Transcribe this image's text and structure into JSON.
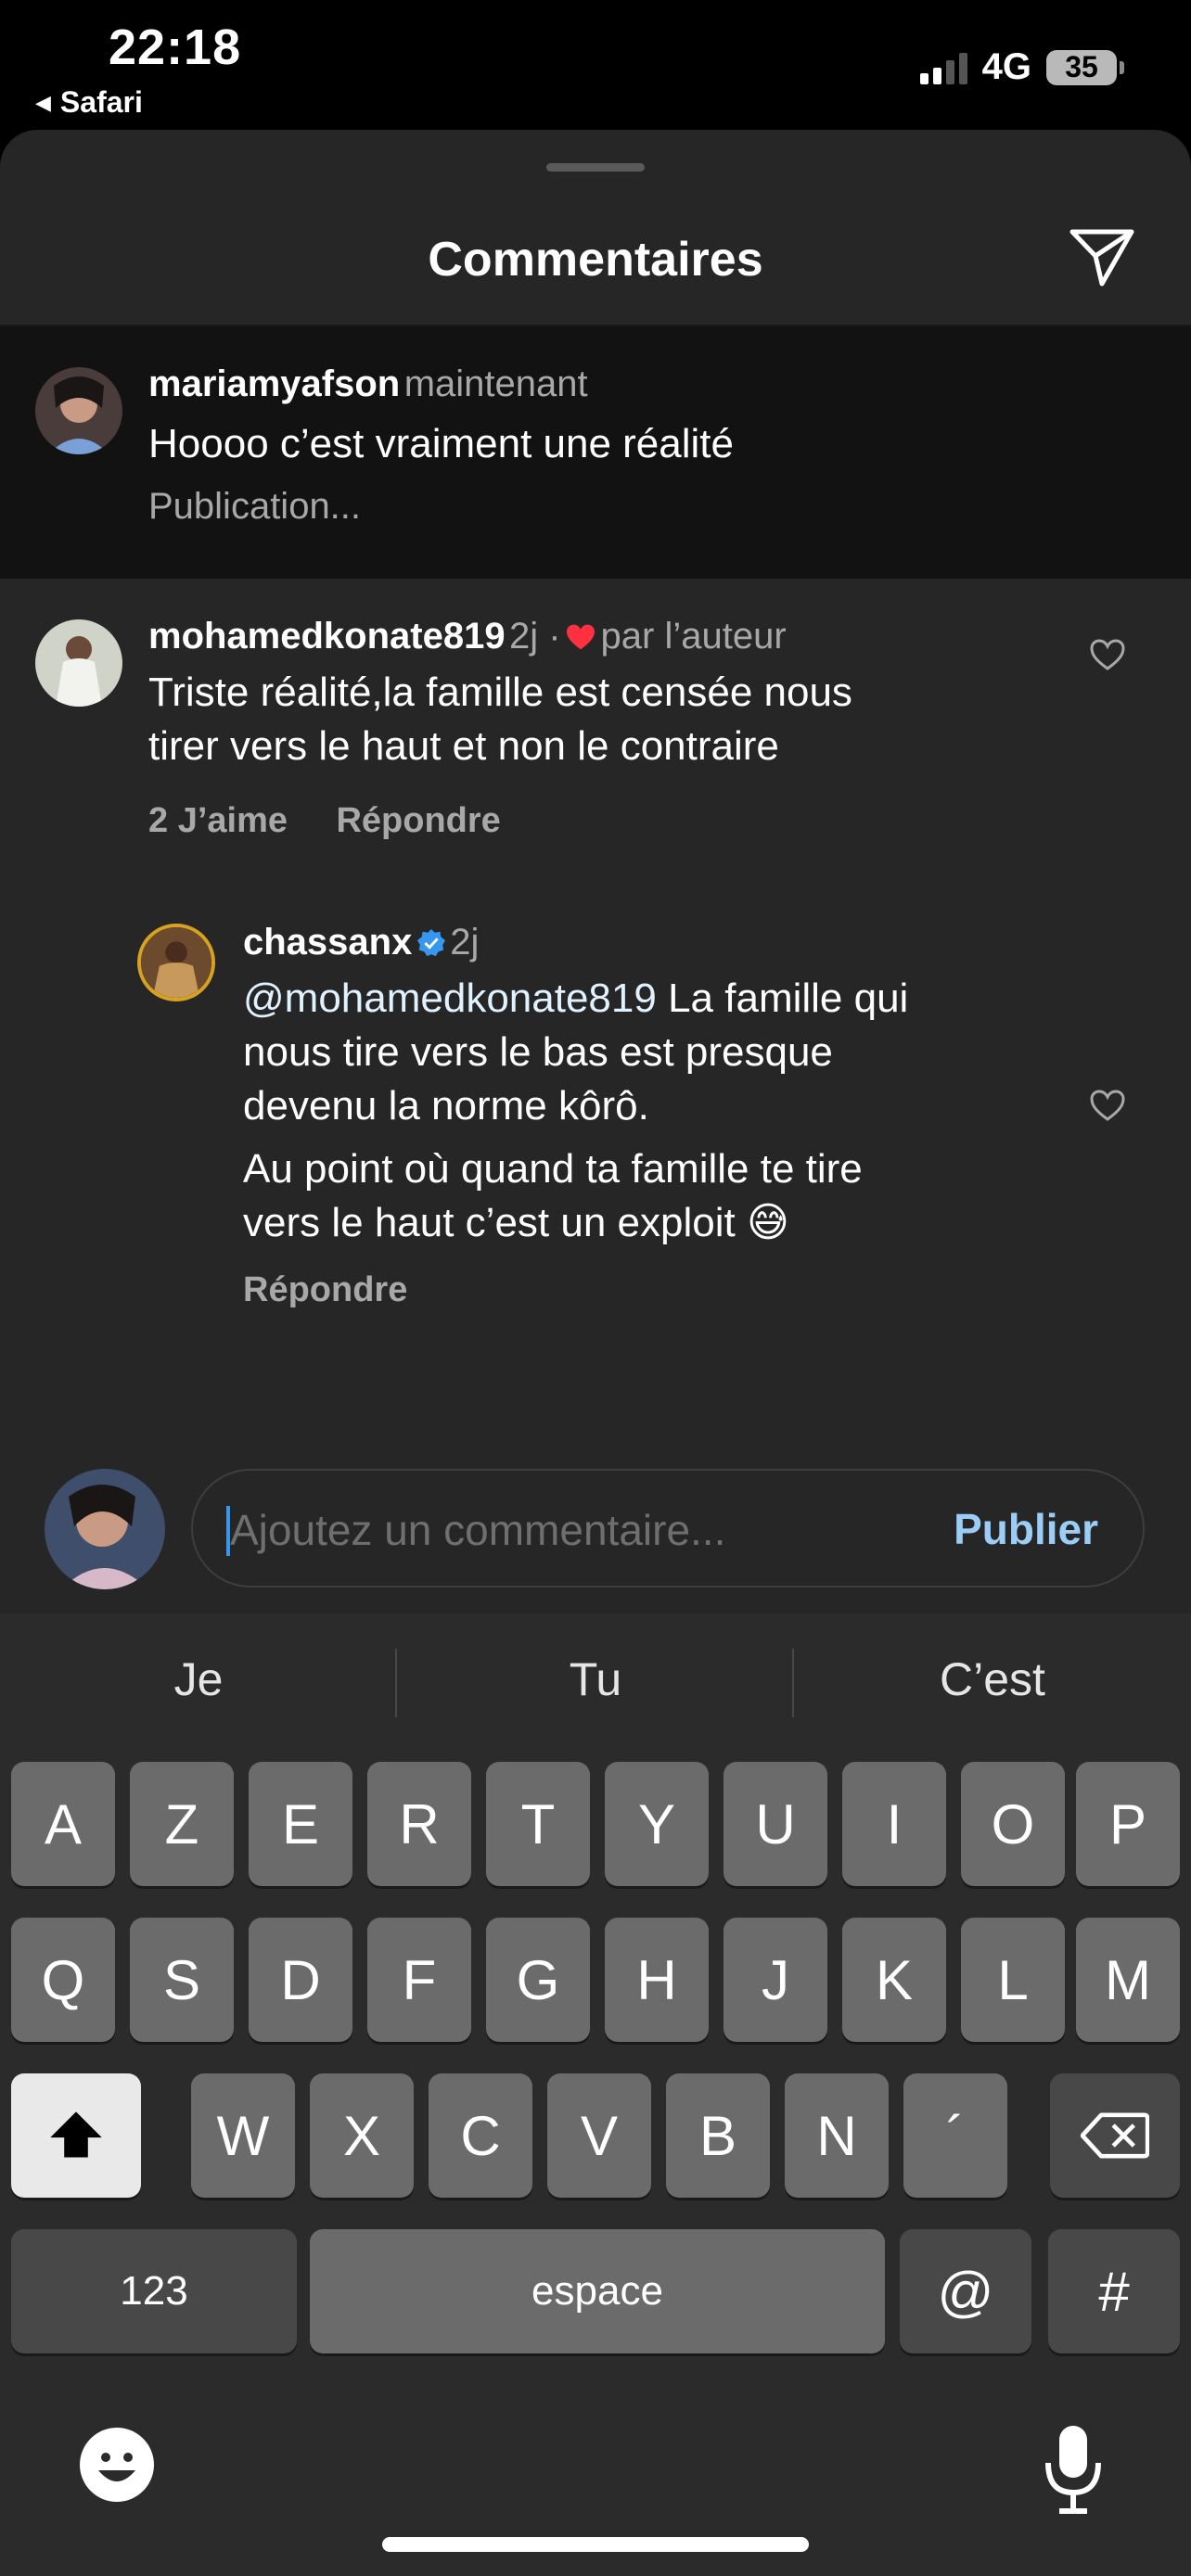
{
  "status_bar": {
    "time": "22:18",
    "back_app": "Safari",
    "network": "4G",
    "battery": "35"
  },
  "sheet": {
    "title": "Commentaires",
    "send_icon": "paper-plane-icon"
  },
  "comments": [
    {
      "username": "mariamyafson",
      "meta": "maintenant",
      "text": "Hoooo c’est vraiment une réalité",
      "status": "Publication..."
    },
    {
      "username": "mohamedkonate819",
      "meta": "2j ·",
      "liked_by_author": "par l’auteur",
      "text_lines": [
        "Triste réalité,la famille est censée nous",
        "tirer vers le haut et non le contraire"
      ],
      "likes": "2 J’aime",
      "reply": "Répondre"
    },
    {
      "username": "chassanx",
      "verified": true,
      "meta": "2j",
      "mention": "@mohamedkonate819",
      "text_lines": [
        "La famille qui",
        "nous tire vers le bas est presque",
        "devenu la norme kôrô.",
        "Au point où quand ta famille te tire",
        "vers le haut c’est un exploit 😅"
      ],
      "reply": "Répondre"
    }
  ],
  "emoji_reactions": [
    "❤️",
    "🙌",
    "🔥",
    "👏",
    "😢",
    "😍",
    "😮",
    "😂"
  ],
  "composer": {
    "placeholder": "Ajoutez un commentaire...",
    "publish_label": "Publier"
  },
  "keyboard": {
    "suggestions": [
      "Je",
      "Tu",
      "C’est"
    ],
    "row1": [
      "A",
      "Z",
      "E",
      "R",
      "T",
      "Y",
      "U",
      "I",
      "O",
      "P"
    ],
    "row2": [
      "Q",
      "S",
      "D",
      "F",
      "G",
      "H",
      "J",
      "K",
      "L",
      "M"
    ],
    "row3": [
      "W",
      "X",
      "C",
      "V",
      "B",
      "N",
      "´"
    ],
    "numbers_label": "123",
    "space_label": "espace",
    "at_label": "@",
    "hash_label": "#"
  }
}
